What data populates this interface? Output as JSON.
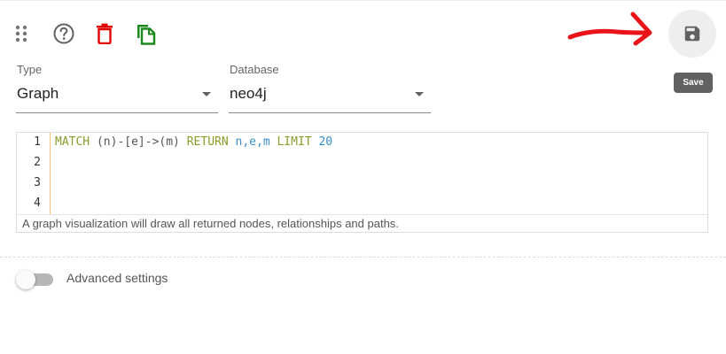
{
  "toolbar": {
    "icons": [
      "drag-handle-icon",
      "help-icon",
      "delete-icon",
      "copy-icon"
    ],
    "delete_color": "#e00000",
    "copy_color": "#1b8a1b"
  },
  "save": {
    "icon": "save-icon",
    "tooltip": "Save"
  },
  "annotation": {
    "arrow_color": "#e8141a"
  },
  "type_select": {
    "label": "Type",
    "value": "Graph"
  },
  "database_select": {
    "label": "Database",
    "value": "neo4j"
  },
  "editor": {
    "line_numbers": [
      "1",
      "2",
      "3",
      "4"
    ],
    "query_tokens": {
      "match": "MATCH",
      "pattern_a": " (n)-[e]->(m) ",
      "return": "RETURN",
      "vars": " n,e,m ",
      "limit": "LIMIT",
      "count": " 20"
    },
    "helper_text": "A graph visualization will draw all returned nodes, relationships and paths."
  },
  "advanced": {
    "label": "Advanced settings",
    "enabled": false
  }
}
